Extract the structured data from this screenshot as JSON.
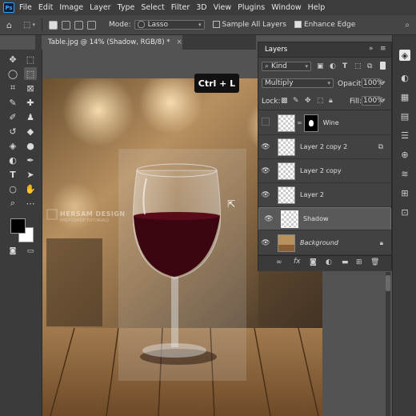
{
  "menubar": {
    "logo": "Ps",
    "items": [
      "File",
      "Edit",
      "Image",
      "Layer",
      "Type",
      "Select",
      "Filter",
      "3D",
      "View",
      "Plugins",
      "Window",
      "Help"
    ]
  },
  "options": {
    "mode_label": "Mode:",
    "mode_value": "Lasso",
    "sample_all_layers": "Sample All Layers",
    "enhance_edge": "Enhance Edge",
    "sample_checked": false,
    "enhance_checked": true
  },
  "document": {
    "tab_title": "Table.jpg @ 14% (Shadow, RGB/8) *",
    "close_glyph": "×"
  },
  "shortcut_badge": "Ctrl + L",
  "watermark": {
    "line1": "HERSAM DESIGN",
    "line2": "PHOTOSHOP TUTORIALS"
  },
  "layers_panel": {
    "title": "Layers",
    "filter_kind": "Kind",
    "blend_mode": "Multiply",
    "opacity_label": "Opacity:",
    "opacity_value": "100%",
    "lock_label": "Lock:",
    "fill_label": "Fill:",
    "fill_value": "100%",
    "layers": [
      {
        "name": "Wine",
        "visible": false,
        "selected": false,
        "italic": false
      },
      {
        "name": "Layer 2 copy 2",
        "visible": true,
        "selected": false,
        "italic": false
      },
      {
        "name": "Layer 2 copy",
        "visible": true,
        "selected": false,
        "italic": false
      },
      {
        "name": "Layer 2",
        "visible": true,
        "selected": false,
        "italic": false
      },
      {
        "name": "Shadow",
        "visible": true,
        "selected": true,
        "italic": false
      },
      {
        "name": "Background",
        "visible": true,
        "selected": false,
        "italic": true
      }
    ]
  },
  "colors": {
    "accent": "#31a8ff",
    "panel": "#424242",
    "selected_row": "#595959",
    "wine": "#3b0610"
  }
}
